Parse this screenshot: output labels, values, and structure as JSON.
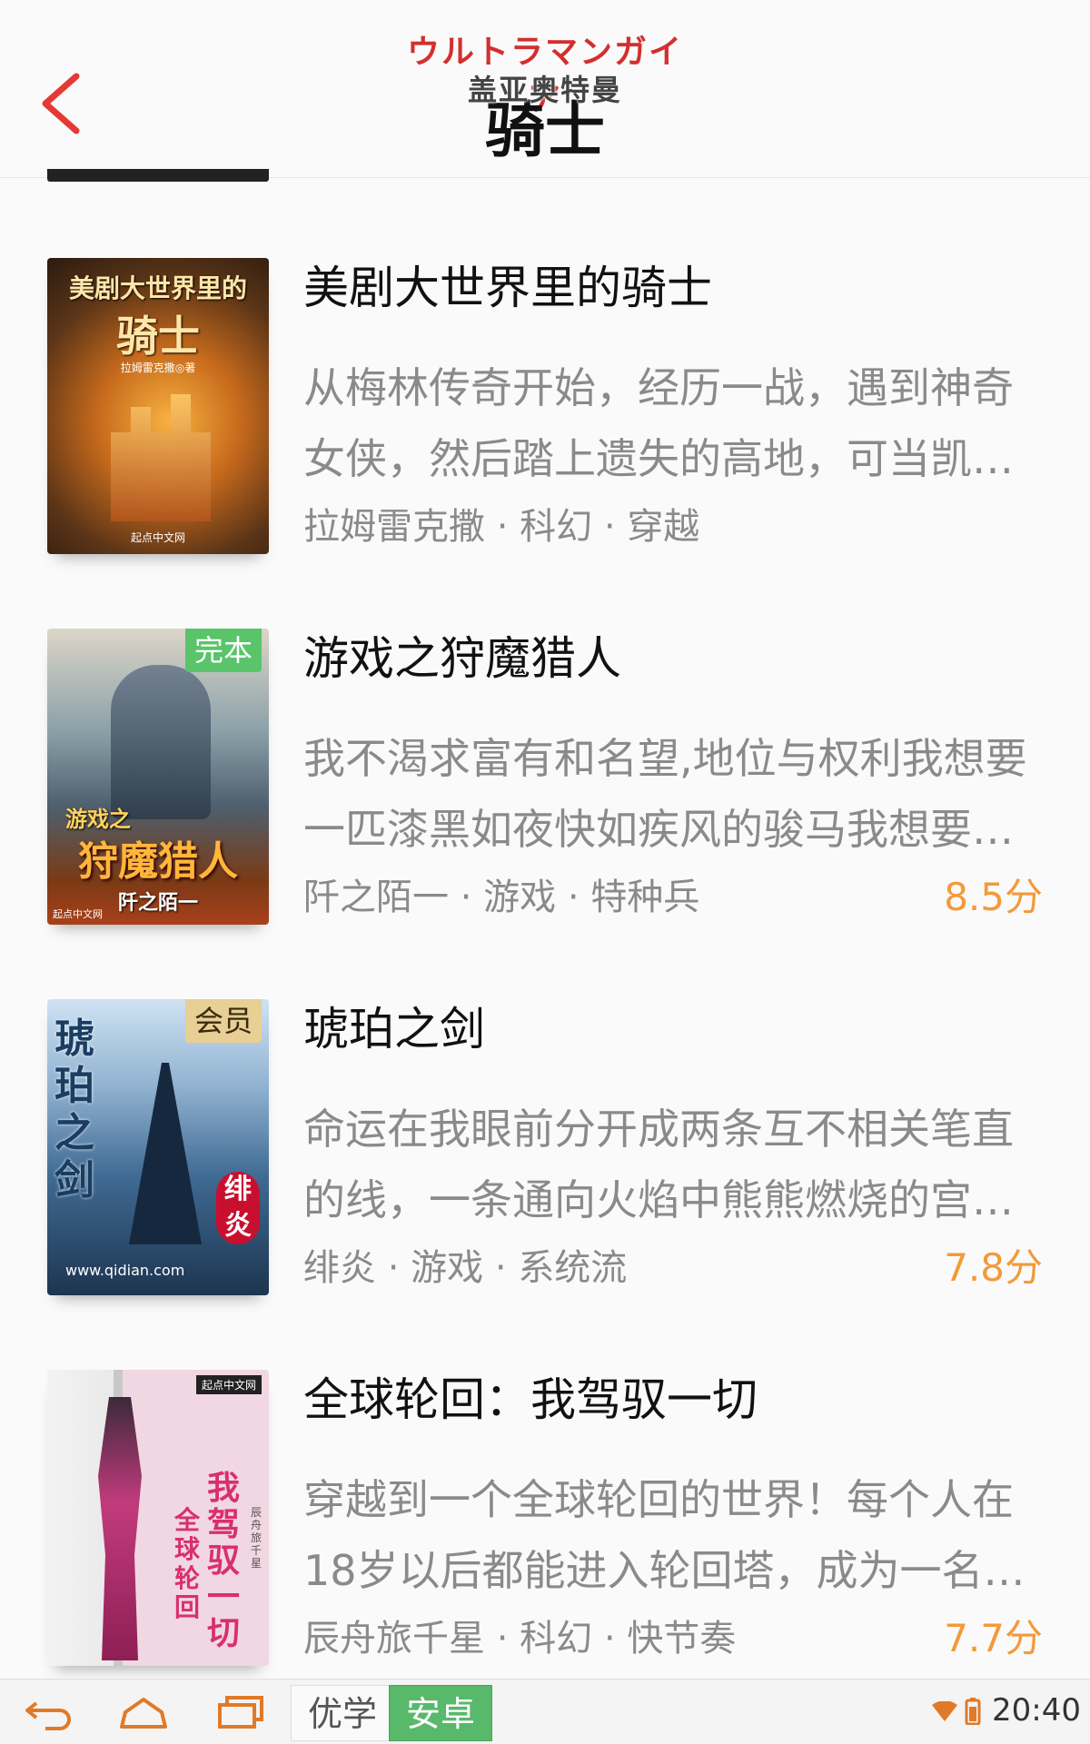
{
  "header": {
    "logo_jp": "ウルトラマンガイア",
    "logo_cn": "盖亚奥特曼",
    "title": "骑士"
  },
  "books": [
    {
      "title": "美剧大世界里的骑士",
      "desc": "从梅林传奇开始，经历一战，遇到神奇女侠，然后踏上遗失的高地，可当凯…",
      "author": "拉姆雷克撒",
      "genre": "科幻",
      "tag": "穿越",
      "score": "",
      "badge": "",
      "cover_title": "美剧大世界里的",
      "cover_sub": "骑士",
      "cover_author": "拉姆雷克撒◎著",
      "cover_brand": "起点中文网"
    },
    {
      "title": "游戏之狩魔猎人",
      "desc": "我不渴求富有和名望,地位与权利我想要一匹漆黑如夜快如疾风的骏马我想要…",
      "author": "阡之陌一",
      "genre": "游戏",
      "tag": "特种兵",
      "score": "8.5分",
      "badge": "完本",
      "cover_title": "游戏之",
      "cover_sub": "狩魔猎人",
      "cover_author": "阡之陌一",
      "cover_brand": "起点中文网"
    },
    {
      "title": "琥珀之剑",
      "desc": "命运在我眼前分开成两条互不相关笔直的线，一条通向火焰中熊熊燃烧的宫…",
      "author": "绯炎",
      "genre": "游戏",
      "tag": "系统流",
      "score": "7.8分",
      "badge": "会员",
      "cover_title": "琥珀之剑",
      "cover_sub": "绯炎",
      "cover_author": "www.qidian.com",
      "cover_brand": ""
    },
    {
      "title": "全球轮回：我驾驭一切",
      "desc": "穿越到一个全球轮回的世界！每个人在18岁以后都能进入轮回塔，成为一名…",
      "author": "辰舟旅千星",
      "genre": "科幻",
      "tag": "快节奏",
      "score": "7.7分",
      "badge": "",
      "cover_title": "我驾驭一切",
      "cover_sub": "全球轮回",
      "cover_author": "辰舟旅千星",
      "cover_brand": "起点中文网"
    }
  ],
  "navbar": {
    "tab_a": "优学",
    "tab_b": "安卓",
    "time": "20:40"
  }
}
